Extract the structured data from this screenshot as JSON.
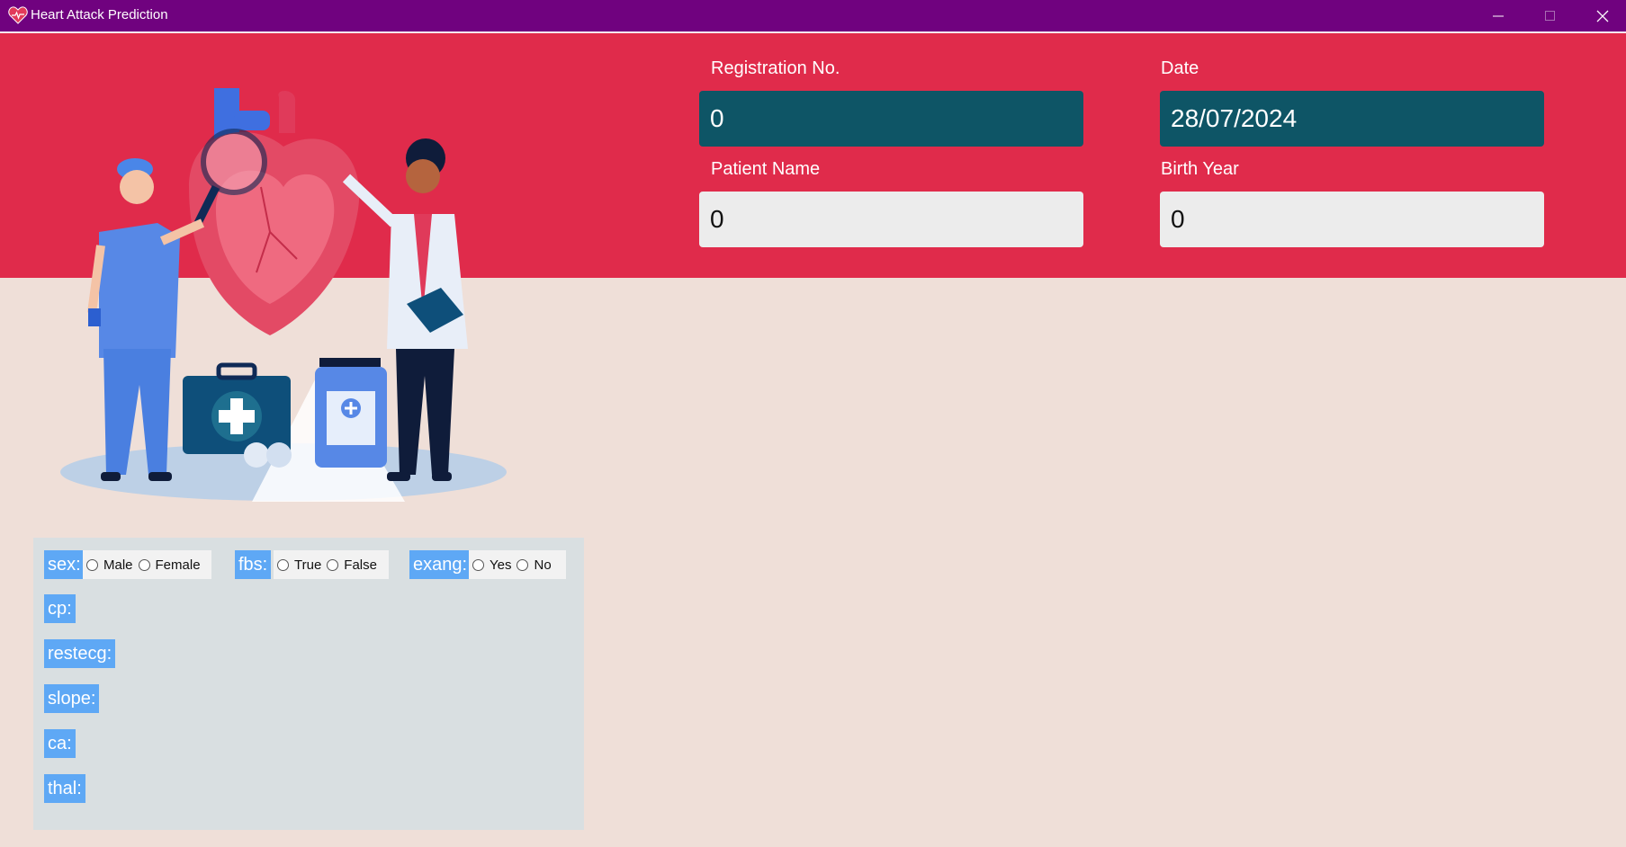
{
  "window": {
    "title": "Heart Attack Prediction",
    "controls": {
      "minimize": "minimize-icon",
      "maximize": "maximize-icon",
      "close": "close-icon"
    }
  },
  "colors": {
    "titlebar": "#70027f",
    "banner": "#e02b4b",
    "background": "#efdfd8",
    "dark_field": "#0e5566",
    "label_bg": "#5ea8f5",
    "panel": "#d9dfe1"
  },
  "form": {
    "registration": {
      "label": "Registration No.",
      "value": "0"
    },
    "date": {
      "label": "Date",
      "value": "28/07/2024"
    },
    "patient_name": {
      "label": "Patient Name",
      "value": "0"
    },
    "birth_year": {
      "label": "Birth Year",
      "value": "0"
    }
  },
  "illustration": "doctors-with-heart-illustration",
  "attributes": {
    "sex": {
      "label": "sex:",
      "options": [
        "Male",
        "Female"
      ]
    },
    "fbs": {
      "label": "fbs:",
      "options": [
        "True",
        "False"
      ]
    },
    "exang": {
      "label": "exang:",
      "options": [
        "Yes",
        "No"
      ]
    },
    "cp": {
      "label": "cp:"
    },
    "restecg": {
      "label": "restecg:"
    },
    "slope": {
      "label": "slope:"
    },
    "ca": {
      "label": "ca:"
    },
    "thal": {
      "label": "thal:"
    }
  }
}
